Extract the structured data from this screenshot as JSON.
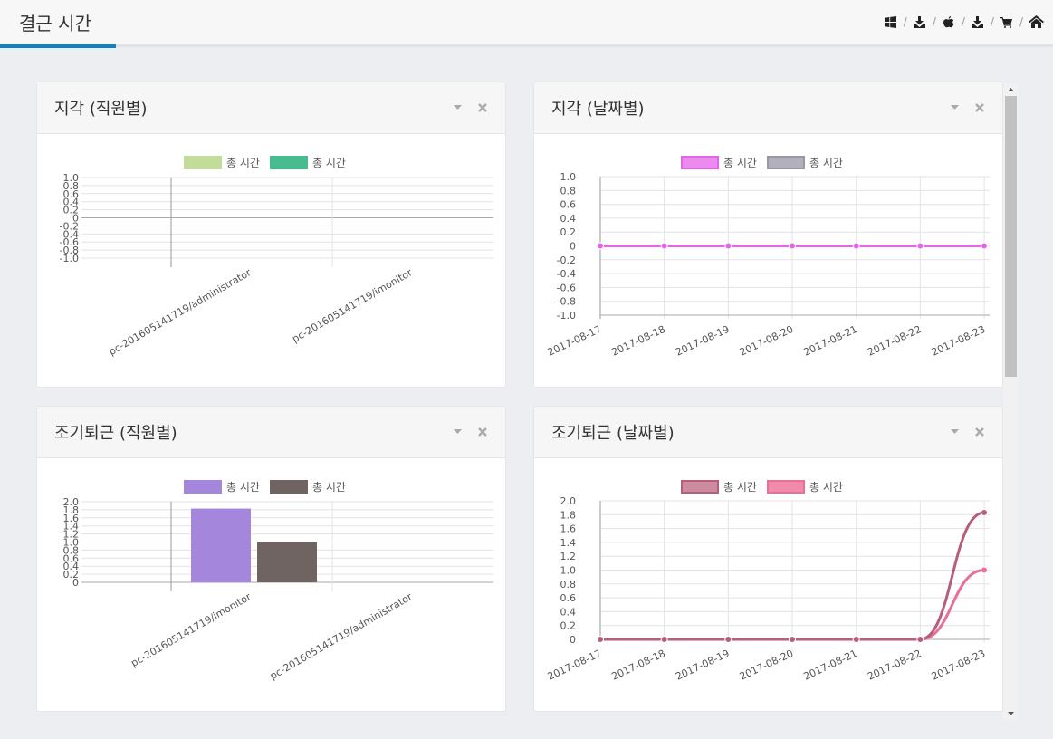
{
  "header": {
    "title": "결근 시간",
    "nav": [
      "windows-icon",
      "download-icon",
      "apple-icon",
      "download-icon",
      "cart-icon",
      "home-icon"
    ],
    "separator": "/"
  },
  "panels": [
    {
      "title": "지각 (직원별)",
      "chart_data": {
        "type": "bar",
        "categories": [
          "pc-20160514171​9/administrator",
          "pc-201605141719/imonitor"
        ],
        "series": [
          {
            "name": "총 시간",
            "values": [
              0,
              0
            ],
            "color": "#c4dc9a"
          },
          {
            "name": "총 시간",
            "values": [
              0,
              0
            ],
            "color": "#47bc8f"
          }
        ],
        "ylim": [
          -1.0,
          1.0
        ],
        "yticks": [
          "1.0",
          "0.8",
          "0.6",
          "0.4",
          "0.2",
          "0",
          "-0.2",
          "-0.4",
          "-0.6",
          "-0.8",
          "-1.0"
        ],
        "grid": true,
        "legend": "top"
      }
    },
    {
      "title": "지각 (날짜별)",
      "chart_data": {
        "type": "line",
        "x": [
          "2017-08-17",
          "2017-08-18",
          "2017-08-19",
          "2017-08-20",
          "2017-08-21",
          "2017-08-22",
          "2017-08-23"
        ],
        "series": [
          {
            "name": "총 시간",
            "values": [
              0,
              0,
              0,
              0,
              0,
              0,
              0
            ],
            "color": "#e466e6",
            "fill": "#ec8bee"
          },
          {
            "name": "총 시간",
            "values": [
              0,
              0,
              0,
              0,
              0,
              0,
              0
            ],
            "color": "#9b98a6",
            "fill": "#b2b0bb"
          }
        ],
        "ylim": [
          -1.0,
          1.0
        ],
        "yticks": [
          "1.0",
          "0.8",
          "0.6",
          "0.4",
          "0.2",
          "0",
          "-0.2",
          "-0.4",
          "-0.6",
          "-0.8",
          "-1.0"
        ],
        "grid": true,
        "legend": "top"
      }
    },
    {
      "title": "조기퇴근 (직원별)",
      "chart_data": {
        "type": "bar",
        "categories": [
          "pc-201605141719/imonitor",
          "pc-201605141719/administrator"
        ],
        "series": [
          {
            "name": "총 시간",
            "values": [
              1.83,
              0
            ],
            "color": "#a487dd"
          },
          {
            "name": "총 시간",
            "values": [
              1.0,
              0
            ],
            "color": "#6f6462"
          }
        ],
        "ylim": [
          0,
          2.0
        ],
        "yticks": [
          "2.0",
          "1.8",
          "1.6",
          "1.4",
          "1.2",
          "1.0",
          "0.8",
          "0.6",
          "0.4",
          "0.2",
          "0"
        ],
        "grid": true,
        "legend": "top"
      }
    },
    {
      "title": "조기퇴근 (날짜별)",
      "chart_data": {
        "type": "line",
        "x": [
          "2017-08-17",
          "2017-08-18",
          "2017-08-19",
          "2017-08-20",
          "2017-08-21",
          "2017-08-22",
          "2017-08-23"
        ],
        "series": [
          {
            "name": "총 시간",
            "values": [
              0,
              0,
              0,
              0,
              0,
              0,
              1.83
            ],
            "color": "#b65e7c",
            "fill": "#cc8b9e"
          },
          {
            "name": "총 시간",
            "values": [
              0,
              0,
              0,
              0,
              0,
              0,
              1.0
            ],
            "color": "#ea6f96",
            "fill": "#f08bab"
          }
        ],
        "ylim": [
          0,
          2.0
        ],
        "yticks": [
          "2.0",
          "1.8",
          "1.6",
          "1.4",
          "1.2",
          "1.0",
          "0.8",
          "0.6",
          "0.4",
          "0.2",
          "0"
        ],
        "grid": true,
        "legend": "top"
      }
    }
  ]
}
